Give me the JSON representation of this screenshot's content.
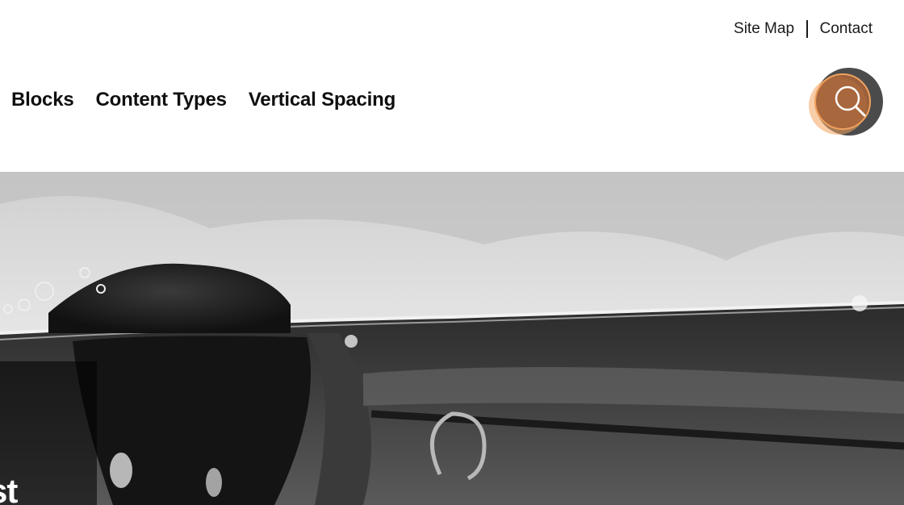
{
  "utility_nav": {
    "site_map": "Site Map",
    "contact": "Contact"
  },
  "main_nav": {
    "items": [
      {
        "label": "Blocks"
      },
      {
        "label": "Content Types"
      },
      {
        "label": "Vertical Spacing"
      }
    ]
  },
  "search": {
    "icon": "search-icon",
    "accent_color": "#f0a15e",
    "dark_color": "#4a4a4a"
  },
  "hero": {
    "title_partial": "st"
  }
}
